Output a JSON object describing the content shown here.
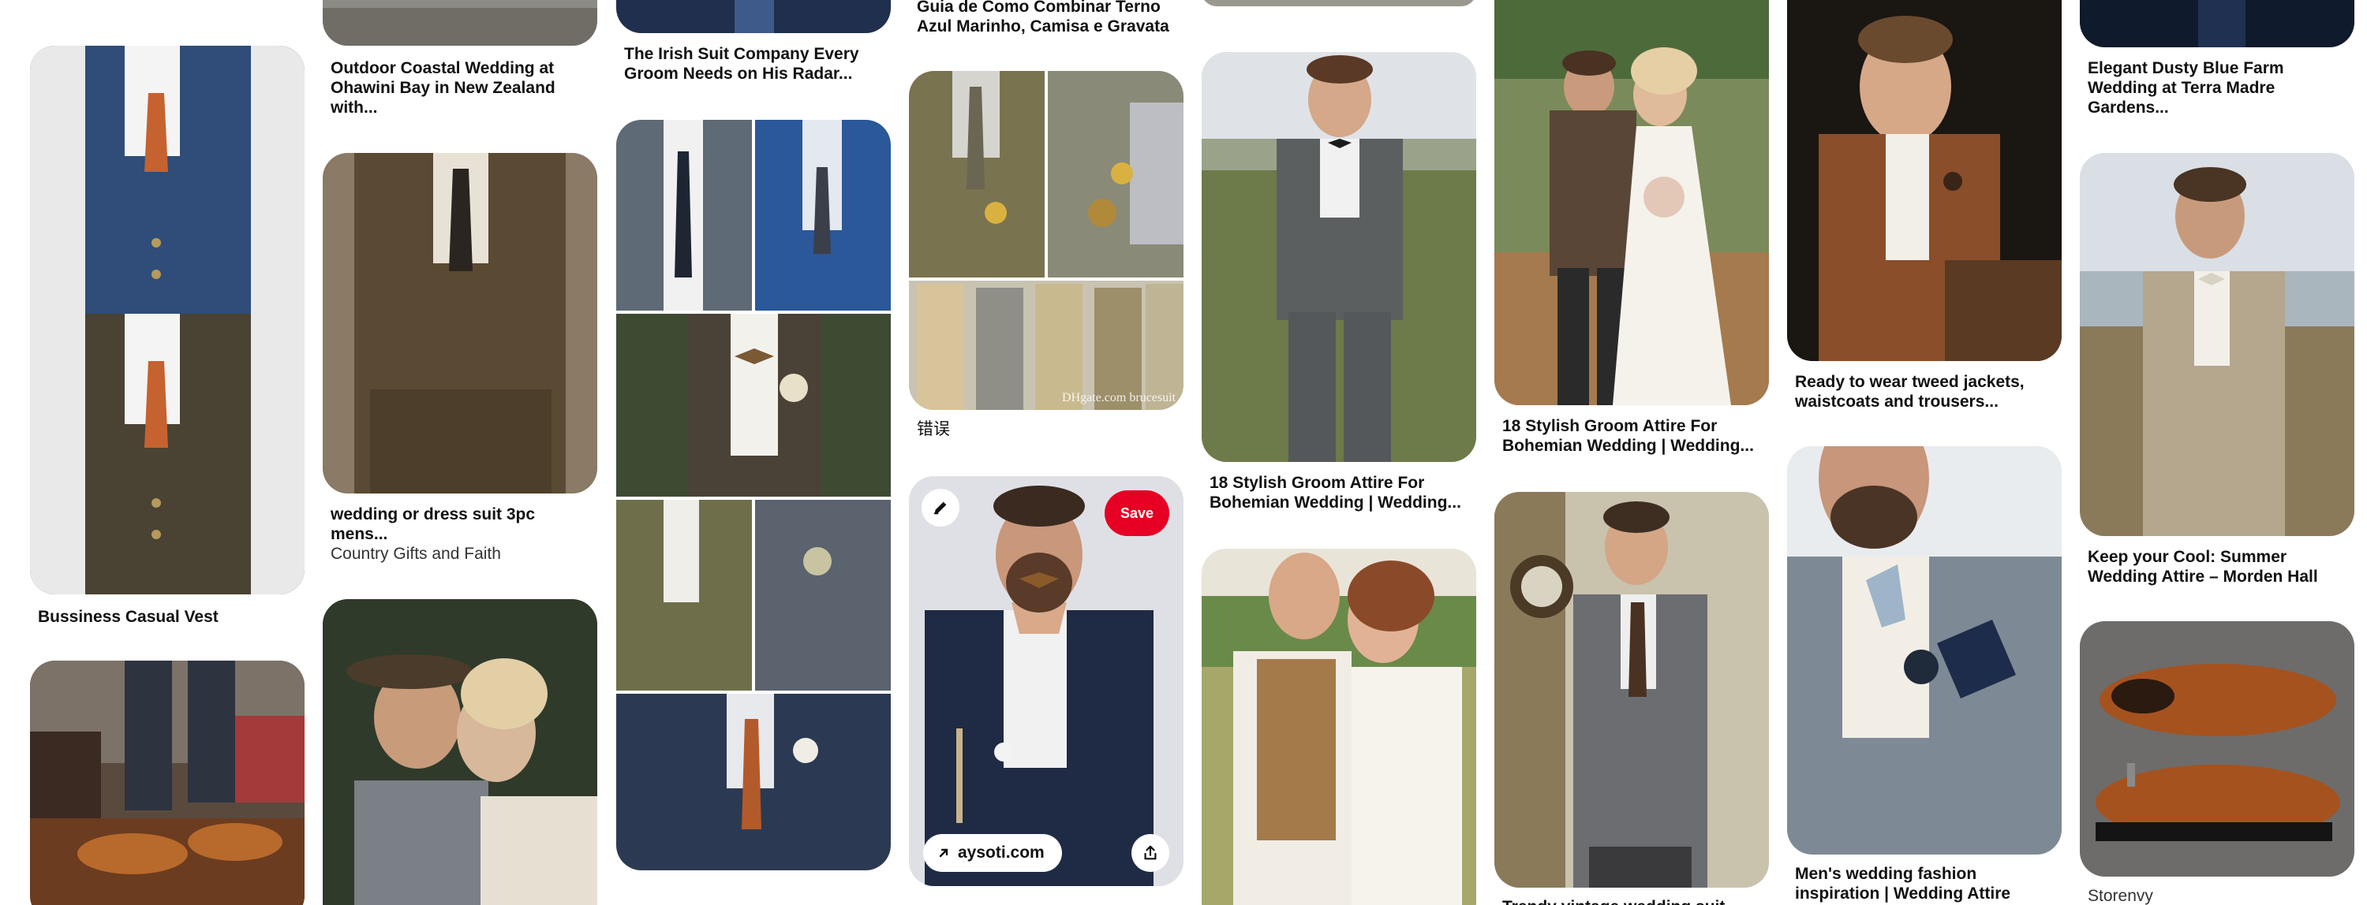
{
  "pins": {
    "bussiness_vest": {
      "title": "Bussiness Casual Vest",
      "subtitle": ""
    },
    "brown_shoes_left": {
      "title": "",
      "subtitle": ""
    },
    "coastal_wedding": {
      "title": "Outdoor Coastal Wedding at Ohawini Bay in New Zealand with...",
      "subtitle": ""
    },
    "dress_suit": {
      "title": "wedding or dress suit 3pc mens...",
      "subtitle": "Country Gifts and Faith"
    },
    "couple_hat": {
      "title": "",
      "subtitle": ""
    },
    "irish_suit": {
      "title": "The Irish Suit Company Every Groom Needs on His Radar...",
      "subtitle": ""
    },
    "collage_grid": {
      "title": "",
      "subtitle": ""
    },
    "guia_terno": {
      "title": "Guia de Como Combinar Terno Azul Marinho, Camisa e Gravata",
      "subtitle": ""
    },
    "tweed_vests": {
      "title": "错误",
      "subtitle": "",
      "watermark": "DHgate.com brucesuit"
    },
    "navy_plaid": {
      "title": "",
      "save_label": "Save",
      "link_label": "aysoti.com"
    },
    "groom_field": {
      "title": "18 Stylish Groom Attire For Bohemian Wedding | Wedding...",
      "subtitle": ""
    },
    "kiss_couple": {
      "title": "",
      "subtitle": ""
    },
    "bohemian_couple": {
      "title": "18 Stylish Groom Attire For Bohemian Wedding | Wedding...",
      "subtitle": ""
    },
    "grey_vintage": {
      "title": "Trendy vintage wedding suit",
      "subtitle": ""
    },
    "tweed_jacket": {
      "title": "Ready to wear tweed jackets, waistcoats and trousers...",
      "subtitle": ""
    },
    "wedding_fashion": {
      "title": "Men's wedding fashion inspiration | Wedding Attire",
      "subtitle": ""
    },
    "dusty_blue": {
      "title": "Elegant Dusty Blue Farm Wedding at Terra Madre Gardens...",
      "subtitle": ""
    },
    "summer_attire": {
      "title": "Keep your Cool: Summer Wedding Attire – Morden Hall",
      "subtitle": ""
    },
    "storenvy_shoes": {
      "title": "",
      "subtitle": "Storenvy"
    }
  },
  "icons": {
    "edit": "pencil-icon",
    "link": "arrow-up-right-icon",
    "share": "share-icon"
  },
  "colors": {
    "save_button": "#e60023",
    "background": "#ffffff",
    "title_text": "#111111"
  }
}
